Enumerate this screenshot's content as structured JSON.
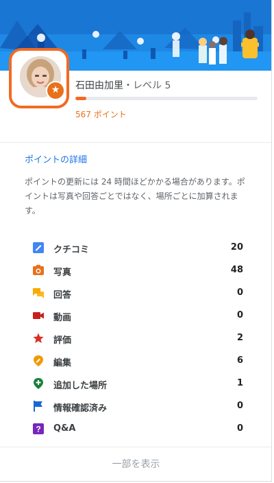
{
  "profile": {
    "name": "石田由加里",
    "separator": "・",
    "level": "レベル 5",
    "progress_fraction": 0.06,
    "points_text": "567 ポイント",
    "avatar_badge_icon": "star-icon"
  },
  "details": {
    "title": "ポイントの詳細",
    "note": "ポイントの更新には 24 時間ほどかかる場合があります。ポイントは写真や回答ごとではなく、場所ごとに加算されます。"
  },
  "stats": [
    {
      "label": "クチコミ",
      "value": "20",
      "icon": "review-pencil-icon",
      "color": "#4285f4"
    },
    {
      "label": "写真",
      "value": "48",
      "icon": "camera-icon",
      "color": "#e8711c"
    },
    {
      "label": "回答",
      "value": "0",
      "icon": "chat-bubbles-icon",
      "color": "#f9ab00"
    },
    {
      "label": "動画",
      "value": "0",
      "icon": "video-camera-icon",
      "color": "#c5221f"
    },
    {
      "label": "評価",
      "value": "2",
      "icon": "star-icon",
      "color": "#d93025"
    },
    {
      "label": "編集",
      "value": "6",
      "icon": "edit-pin-icon",
      "color": "#f29900"
    },
    {
      "label": "追加した場所",
      "value": "1",
      "icon": "add-place-pin-icon",
      "color": "#188038"
    },
    {
      "label": "情報確認済み",
      "value": "0",
      "icon": "flag-icon",
      "color": "#1967d2"
    },
    {
      "label": "Q&A",
      "value": "0",
      "icon": "question-icon",
      "color": "#7627bb"
    }
  ],
  "footer": {
    "show_more": "一部を表示"
  },
  "colors": {
    "accent": "#1a73e8",
    "points": "#e8711c",
    "avatar_frame": "#f26a21"
  }
}
